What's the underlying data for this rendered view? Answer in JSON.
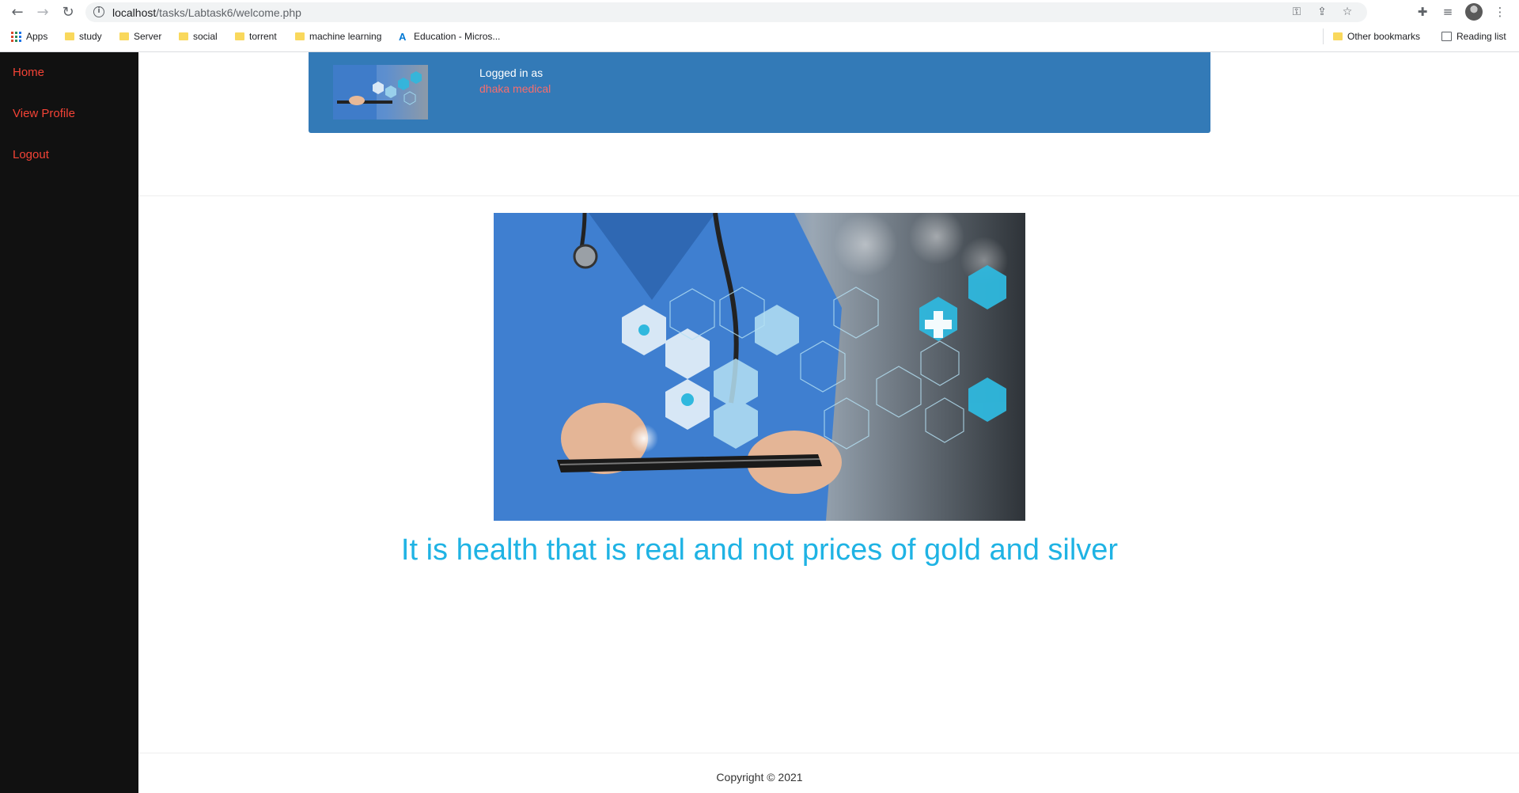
{
  "browser": {
    "url_host": "localhost",
    "url_path": "/tasks/Labtask6/welcome.php",
    "bookmarks": [
      {
        "label": "Apps",
        "icon": "apps-grid-icon"
      },
      {
        "label": "study",
        "icon": "folder-icon"
      },
      {
        "label": "Server",
        "icon": "folder-icon"
      },
      {
        "label": "social",
        "icon": "folder-icon"
      },
      {
        "label": "torrent",
        "icon": "folder-icon"
      },
      {
        "label": "machine learning",
        "icon": "folder-icon"
      },
      {
        "label": "Education - Micros...",
        "icon": "azure-icon"
      }
    ],
    "other_bookmarks": "Other bookmarks",
    "reading_list": "Reading list"
  },
  "sidebar": {
    "items": [
      {
        "label": "Home"
      },
      {
        "label": "View Profile"
      },
      {
        "label": "Logout"
      }
    ],
    "link_color": "#f44336",
    "background": "#111111"
  },
  "header": {
    "logged_in_label": "Logged in as",
    "username": "dhaka medical",
    "background": "#337ab7"
  },
  "main": {
    "quote": "It is health that is real and not prices of gold and silver",
    "quote_color": "#1fb3e4"
  },
  "footer": {
    "copyright": "Copyright © 2021"
  }
}
